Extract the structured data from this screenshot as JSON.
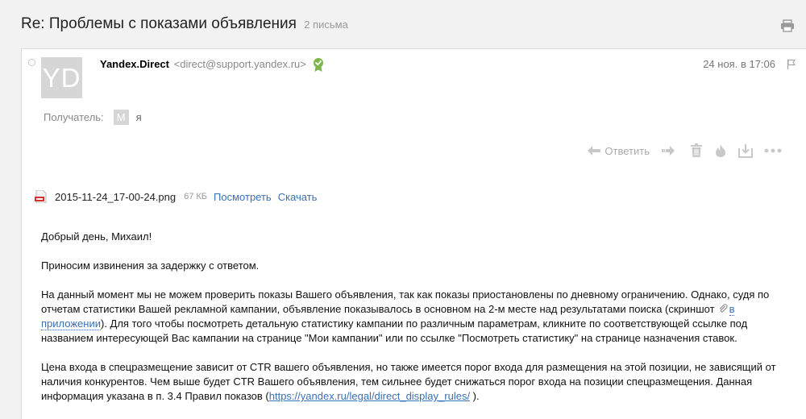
{
  "thread": {
    "subject": "Re: Проблемы с показами объявления",
    "message_count": "2 письма"
  },
  "message": {
    "avatar_initials": "YD",
    "sender_name": "Yandex.Direct",
    "sender_email": "<direct@support.yandex.ru>",
    "date": "24 ноя. в 17:06",
    "recipient_label": "Получатель:",
    "recipient_initial": "М",
    "recipient_name": "я"
  },
  "toolbar": {
    "reply_label": "Ответить",
    "icons": [
      "reply-arrow-icon",
      "forward-arrow-icon",
      "trash-icon",
      "fire-icon",
      "download-icon",
      "more-icon"
    ]
  },
  "attachment": {
    "file_name": "2015-11-24_17-00-24.png",
    "file_size": "67 КБ",
    "view_label": "Посмотреть",
    "download_label": "Скачать"
  },
  "body": {
    "greeting": "Добрый день, Михаил!",
    "apology": "Приносим извинения за задержку с ответом.",
    "p3_part1": "На данный момент мы не можем проверить показы Вашего объявления, так как показы приостановлены по дневному ограничению.  Однако, судя по отчетам статистики Вашей рекламной кампании, объявление показывалось в основном на 2-м месте над результатами поиска (скриншот",
    "p3_link": "в приложении",
    "p3_part2": "). Для того чтобы посмотреть детальную статистику кампании по различным параметрам, кликните по соответствующей ссылке под названием интересующей Вас кампании на странице \"Мои кампании\" или по ссылке \"Посмотреть статистику\" на странице назначения ставок.",
    "p4_part1": "Цена входа в спецразмещение зависит от CTR вашего объявления, но также имеется порог входа для размещения на этой позиции, не зависящий от наличия конкурентов. Чем выше будет CTR Вашего объявления, тем сильнее будет снижаться порог входа на позиции спецразмещения. Данная информация указана в п. 3.4 Правил показов (",
    "p4_link": "https://yandex.ru/legal/direct_display_rules/",
    "p4_part2": " )."
  },
  "colors": {
    "link": "#3a70b5",
    "muted": "#999999",
    "avatar_bg": "#d6d6d6",
    "verified_green": "#7ab648"
  }
}
